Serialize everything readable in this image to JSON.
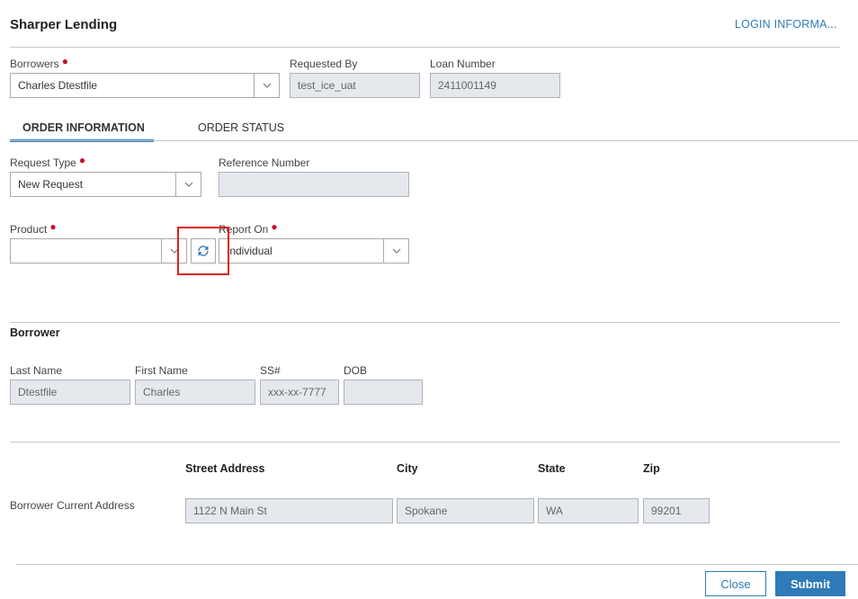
{
  "header": {
    "title": "Sharper Lending",
    "login_link": "LOGIN INFORMA..."
  },
  "top_fields": {
    "borrowers_label": "Borrowers",
    "borrowers_value": "Charles Dtestfile",
    "requested_by_label": "Requested By",
    "requested_by_value": "test_ice_uat",
    "loan_number_label": "Loan Number",
    "loan_number_value": "2411001149"
  },
  "tabs": [
    {
      "label": "ORDER INFORMATION",
      "active": true
    },
    {
      "label": "ORDER STATUS",
      "active": false
    }
  ],
  "order": {
    "request_type_label": "Request Type",
    "request_type_value": "New Request",
    "reference_number_label": "Reference Number",
    "reference_number_value": "",
    "product_label": "Product",
    "product_value": "",
    "report_on_label": "Report On",
    "report_on_value": "Individual"
  },
  "borrower": {
    "section_title": "Borrower",
    "last_name_label": "Last Name",
    "last_name_value": "Dtestfile",
    "first_name_label": "First Name",
    "first_name_value": "Charles",
    "ssn_label": "SS#",
    "ssn_value": "xxx-xx-7777",
    "dob_label": "DOB",
    "dob_value": ""
  },
  "address": {
    "row_label": "Borrower Current Address",
    "street_header": "Street Address",
    "city_header": "City",
    "state_header": "State",
    "zip_header": "Zip",
    "street_value": "1122 N Main St",
    "city_value": "Spokane",
    "state_value": "WA",
    "zip_value": "99201"
  },
  "footer": {
    "close_label": "Close",
    "submit_label": "Submit"
  },
  "colors": {
    "accent": "#2f7ab8",
    "required": "#c8102e",
    "highlight": "#e01b1b",
    "readonly_bg": "#e5e8ec"
  },
  "icons": {
    "chevron": "chevron-down-icon",
    "refresh": "refresh-icon"
  }
}
